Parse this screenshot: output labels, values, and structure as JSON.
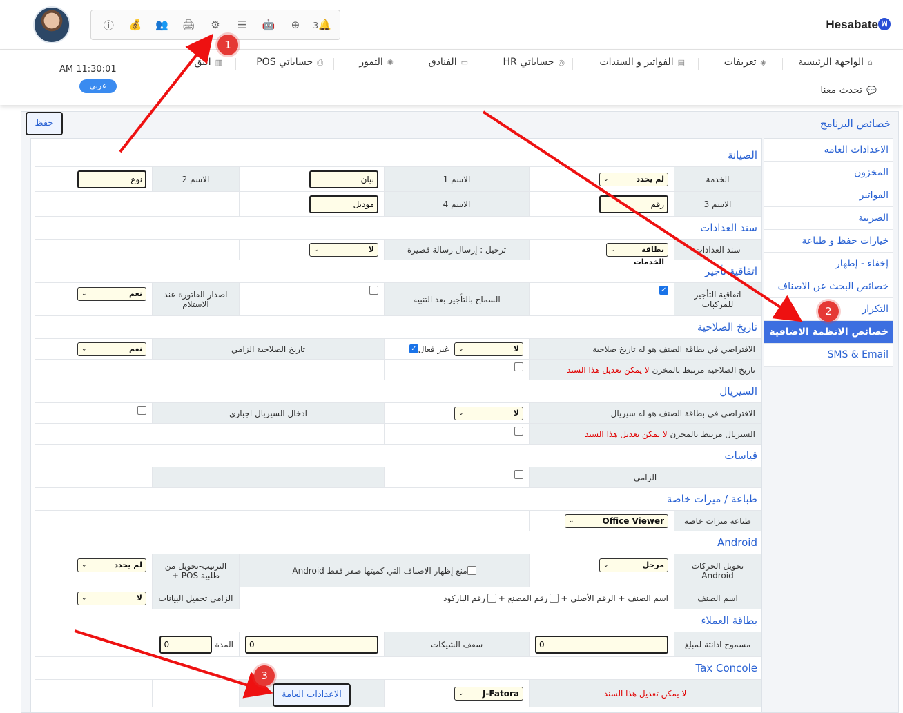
{
  "header": {
    "brand": "Hesabate",
    "icons": [
      "info-icon",
      "money-bag-icon",
      "users-icon",
      "printer-icon",
      "gears-icon",
      "database-icon",
      "android-icon",
      "add-circle-icon",
      "notifications-icon"
    ],
    "notification_count": "3",
    "clock": "AM 11:30:01",
    "language_button": "عربي"
  },
  "nav": {
    "items": [
      "الواجهة الرئيسية",
      "تعريفات",
      "الفواتير و السندات",
      "حساباتي HR",
      "الفنادق",
      "التمور",
      "حساباتي POS",
      "التق"
    ],
    "chat": "تحدث معنا"
  },
  "page": {
    "title": "خصائص البرنامج",
    "save_label": "حفظ"
  },
  "sidebar": {
    "items": [
      "الاعدادات العامة",
      "المخزون",
      "الفواتير",
      "الضريبة",
      "خيارات حفظ و طباعة",
      "إخفاء - إظهار",
      "خصائص البحث عن الاصناف",
      "التكرار",
      "خصائص الانظمة الاضافية",
      "SMS & Email"
    ],
    "active_index": 8
  },
  "form": {
    "maintenance": {
      "title": "الصيانة",
      "service_label": "الخدمة",
      "service_value": "لم يحدد",
      "name1_label": "الاسم 1",
      "name1_value": "بيان",
      "name2_label": "الاسم 2",
      "name2_value": "نوع",
      "name3_label": "الاسم 3",
      "name3_value": "رقم",
      "name4_label": "الاسم 4",
      "name4_value": "موديل"
    },
    "counter_voucher": {
      "title": "سند العدادات",
      "label": "سند العدادات",
      "value": "بطاقة الخدمات",
      "sms_label": "ترحيل : إرسال رسالة قصيرة",
      "sms_value": "لا"
    },
    "rental": {
      "title": "اتفاقية تأجير",
      "vehicle_label": "اتفاقية التأجير للمركبات",
      "allow_after_alert_label": "السماح بالتأجير بعد التنبيه",
      "invoice_on_receipt_label": "اصدار الفاتورة عند الاستلام",
      "invoice_on_receipt_value": "نعم"
    },
    "expiry": {
      "title": "تاريخ الصلاحية",
      "default_label": "الافتراضي في بطاقة الصنف هو له تاريخ صلاحية",
      "default_value": "لا",
      "inactive_label": "غير فعال",
      "mandatory_label": "تاريخ الصلاحية الزامي",
      "mandatory_value": "نعم",
      "linked_label": "تاريخ الصلاحية مرتبط بالمخزن",
      "cannot_edit": "لا يمكن تعديل هذا السند"
    },
    "serial": {
      "title": "السيريال",
      "default_label": "الافتراضي في بطاقة الصنف هو له سيريال",
      "default_value": "لا",
      "mandatory_label": "ادخال السيريال اجباري",
      "linked_label": "السيريال مرتبط بالمخزن",
      "cannot_edit": "لا يمكن تعديل هذا السند"
    },
    "sizes": {
      "title": "قياسات",
      "mandatory_label": "الزامي"
    },
    "printing": {
      "title": "طباعة / ميزات خاصة",
      "label": "طباعة ميزات خاصة",
      "value": "Office Viewer"
    },
    "android": {
      "title": "Android",
      "convert_label": "تحويل الحركات Android",
      "convert_value": "مرحل",
      "hide_zero_label": "منع إظهار الاصناف التي كميتها صفر فقط Android",
      "order_label": "الترتيب-تحويل من طلبية POS +",
      "order_value": "لم يحدد",
      "item_name_label": "اسم الصنف",
      "opt_original": "اسم الصنف + الرقم الأصلي +",
      "opt_factory": "رقم المصنع +",
      "opt_barcode": "رقم الباركود",
      "load_data_label": "الزامي تحميل البيانات",
      "load_data_value": "لا"
    },
    "customers": {
      "title": "بطاقة العملاء",
      "debt_label": "مسموح ادانتة لمبلغ",
      "debt_value": "0",
      "cheques_label": "سقف الشيكات",
      "cheques_value": "0",
      "period_label": "المدة",
      "period_value": "0"
    },
    "tax": {
      "title": "Tax Concole",
      "cannot_edit": "لا يمكن تعديل هذا السند",
      "provider_value": "J-Fatora",
      "general_settings_button": "الاعدادات العامة"
    }
  },
  "annotations": [
    "1",
    "2",
    "3"
  ]
}
